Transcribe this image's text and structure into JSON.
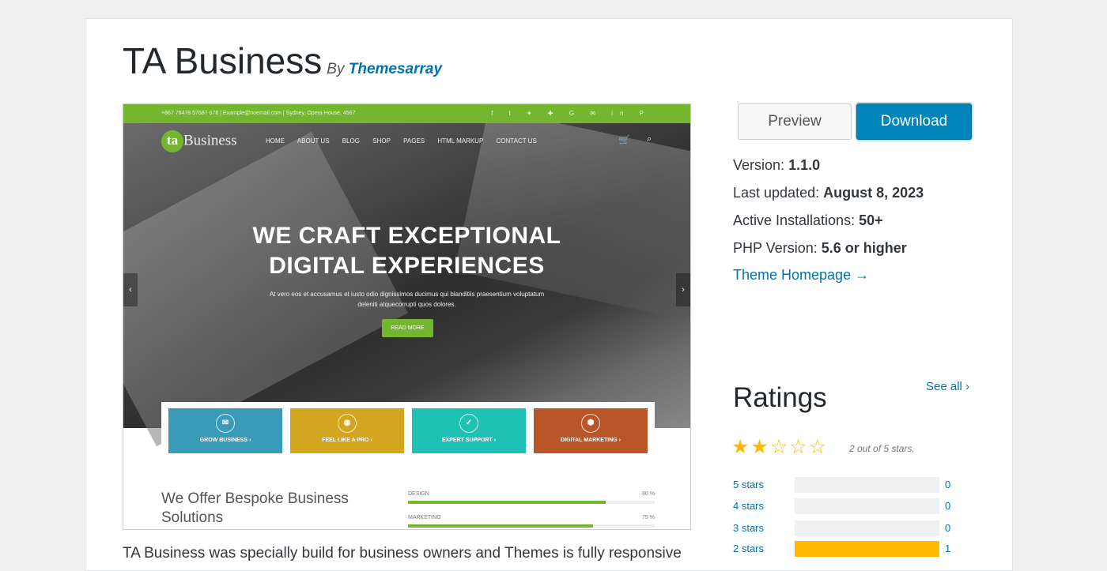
{
  "theme": {
    "name": "TA Business",
    "by_label": "By",
    "author": "Themesarray"
  },
  "screenshot": {
    "topbar": {
      "contact": "+867 76478 57687 678   |   Example@noemail.com   |   Sydney, Opera House, 4567",
      "social": "f t ✦ ✚ G ✉ in P"
    },
    "logo_badge": "ta",
    "logo_text": "Business",
    "menu": [
      "HOME",
      "ABOUT US",
      "BLOG",
      "SHOP",
      "PAGES",
      "HTML MARKUP",
      "CONTACT US"
    ],
    "headline_1": "WE CRAFT EXCEPTIONAL",
    "headline_2": "DIGITAL EXPERIENCES",
    "subline_1": "At vero eos et accusamus et iusto odio dignissimos ducimus qui blanditiis praesentium voluptatum",
    "subline_2": "deleniti atquecorrupti quos dolores.",
    "read_more": "READ MORE",
    "tiles": [
      {
        "label": "GROW BUSINESS  ›",
        "color": "#3a9bb8"
      },
      {
        "label": "FEEL LIKE A PRO  ›",
        "color": "#d4a51e"
      },
      {
        "label": "EXPERT SUPPORT  ›",
        "color": "#1fc1b5"
      },
      {
        "label": "DIGITAL MARKETING  ›",
        "color": "#b8562a"
      }
    ],
    "offer_title": "We Offer Bespoke Business Solutions",
    "skills": [
      {
        "name": "DESIGN",
        "pct_label": "80 %",
        "pct": 80
      },
      {
        "name": "MARKETING",
        "pct_label": "75 %",
        "pct": 75
      }
    ]
  },
  "actions": {
    "preview": "Preview",
    "download": "Download"
  },
  "meta": {
    "version_label": "Version:",
    "version": "1.1.0",
    "updated_label": "Last updated:",
    "updated": "August 8, 2023",
    "installs_label": "Active Installations:",
    "installs": "50+",
    "php_label": "PHP Version:",
    "php": "5.6 or higher",
    "homepage": "Theme Homepage →"
  },
  "ratings": {
    "title": "Ratings",
    "see_all": "See all  ›",
    "stars_filled": "★★",
    "stars_empty": "☆☆☆",
    "summary": "2 out of 5 stars.",
    "rows": [
      {
        "label": "5 stars",
        "count": "0",
        "fraction": 0
      },
      {
        "label": "4 stars",
        "count": "0",
        "fraction": 0
      },
      {
        "label": "3 stars",
        "count": "0",
        "fraction": 0
      },
      {
        "label": "2 stars",
        "count": "1",
        "fraction": 1
      }
    ]
  },
  "description": "TA Business was specially build for business owners and Themes is fully responsive"
}
